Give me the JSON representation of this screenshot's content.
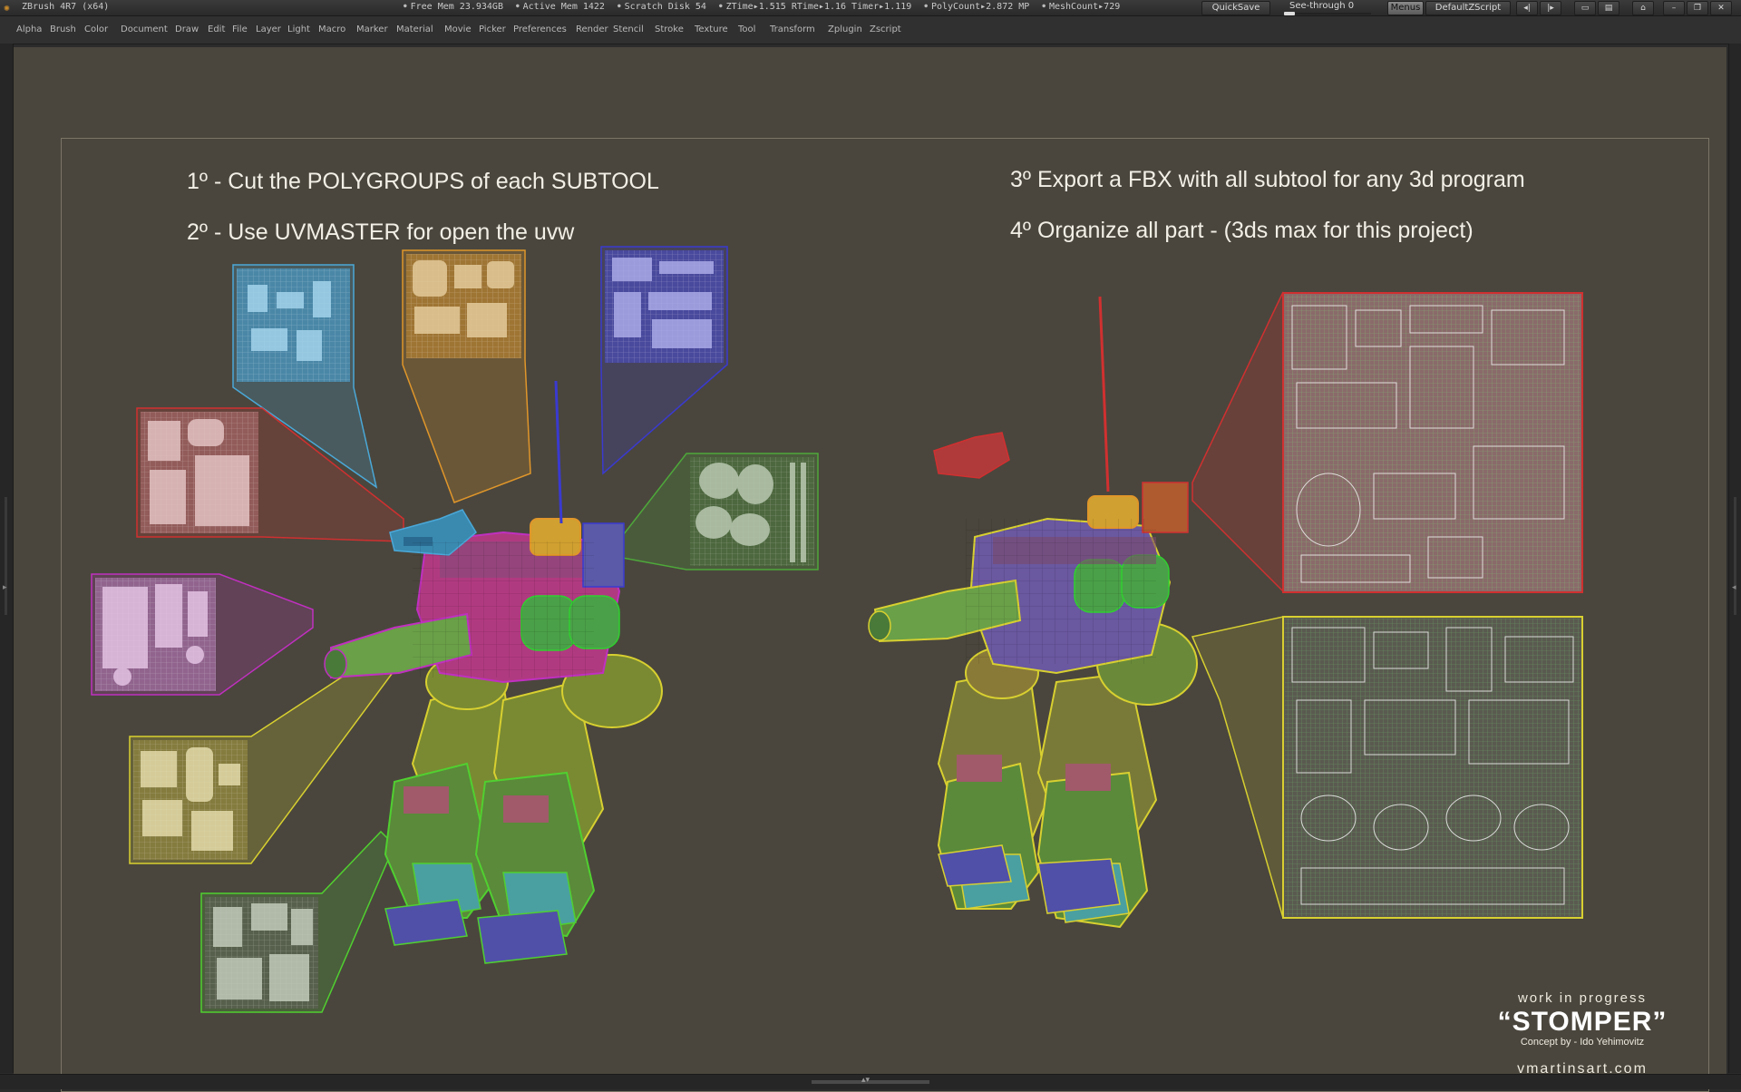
{
  "titlebar": {
    "app_title": "ZBrush 4R7 (x64)",
    "stats": [
      "Free Mem 23.934GB",
      "Active Mem 1422",
      "Scratch Disk 54",
      "ZTime▸1.515 RTime▸1.16 Timer▸1.119",
      "PolyCount▸2.872 MP",
      "MeshCount▸729"
    ],
    "quicksave": "QuickSave",
    "seethrough": "See-through  0",
    "menus": "Menus",
    "default_zscript": "DefaultZScript"
  },
  "menubar": {
    "items": [
      "Alpha",
      "Brush",
      "Color",
      "Document",
      "Draw",
      "Edit",
      "File",
      "Layer",
      "Light",
      "Macro",
      "Marker",
      "Material",
      "Movie",
      "Picker",
      "Preferences",
      "Render",
      "Stencil",
      "Stroke",
      "Texture",
      "Tool",
      "Transform",
      "Zplugin",
      "Zscript"
    ]
  },
  "canvas": {
    "headline_1": "1º - Cut the POLYGROUPS of each SUBTOOL",
    "headline_2": "2º - Use UVMASTER for open the uvw",
    "headline_3": "3º Export a FBX with all subtool for any 3d program",
    "headline_4": "4º Organize all part  - (3ds max for this project)",
    "wip_label": "work in progress",
    "project_title": "“STOMPER”",
    "concept_credit": "Concept by - Ido Yehimovitz",
    "site_url": "vmartinsart.com"
  },
  "colors": {
    "canvas_bg": "#4a463d",
    "uv_cyan": "#4aa8d8",
    "uv_orange": "#e0962a",
    "uv_blue": "#3a3ad0",
    "uv_green": "#4ea83a",
    "uv_red": "#d03030",
    "uv_magenta": "#c030c0",
    "uv_yellow": "#d8d030",
    "uv_lime": "#50d030"
  }
}
